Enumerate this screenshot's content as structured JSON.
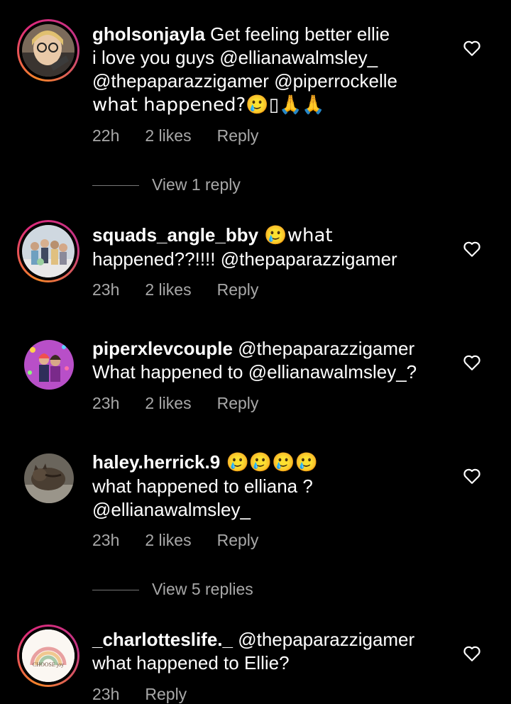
{
  "colors": {
    "background": "#000000",
    "text": "#ffffff",
    "meta": "#a8a8a8",
    "story_ring": "#dd2a7b"
  },
  "comments": [
    {
      "username": "gholsonjayla",
      "text_l1": " Get feeling better ellie",
      "text_l2": "i love you guys @ellianawalmsley_",
      "text_l3": "@thepaparazzigamer @piperrockelle",
      "text_l4": "what happened?🥲▯🙏🙏",
      "time": "22h",
      "likes": "2 likes",
      "reply": "Reply",
      "view_replies": "View 1 reply",
      "has_story_ring": true
    },
    {
      "username": "squads_angle_bby",
      "text_l1": " 🥲what",
      "text_l2": "happened??!!!! @thepaparazzigamer",
      "time": "23h",
      "likes": "2 likes",
      "reply": "Reply",
      "has_story_ring": true
    },
    {
      "username": "piperxlevcouple",
      "text_l1": " @thepaparazzigamer",
      "text_l2": "What happened to @ellianawalmsley_?",
      "time": "23h",
      "likes": "2 likes",
      "reply": "Reply",
      "has_story_ring": false
    },
    {
      "username": "haley.herrick.9",
      "text_l1": " 🥲🥲🥲🥲",
      "text_l2": "what happened to elliana ?",
      "text_l3": "@ellianawalmsley_",
      "time": "23h",
      "likes": "2 likes",
      "reply": "Reply",
      "view_replies": "View 5 replies",
      "has_story_ring": false
    },
    {
      "username": "_charlotteslife._",
      "text_l1": " @thepaparazzigamer",
      "text_l2": "what happened to Ellie?",
      "time": "23h",
      "reply": "Reply",
      "has_story_ring": true,
      "avatar_text": "CHOOSE joy"
    }
  ],
  "icons": {
    "like": "heart-outline-icon"
  }
}
